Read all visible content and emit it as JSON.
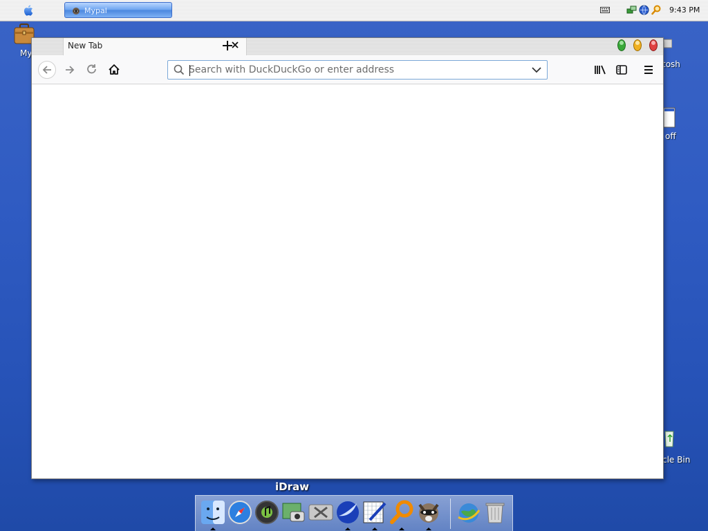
{
  "menubar": {
    "taskbar_app_label": "Mypal",
    "clock": "9:43 PM",
    "tray_icons": [
      "keyboard-icon",
      "network-icon",
      "globe-icon",
      "search-icon"
    ]
  },
  "desktop": {
    "icons": [
      {
        "name": "briefcase-icon",
        "label": "My Briefc"
      },
      {
        "name": "macintosh-hd-icon",
        "label": "tosh"
      },
      {
        "name": "shutoff-icon",
        "label": "off"
      },
      {
        "name": "recycle-bin-icon",
        "label": "cle Bin"
      }
    ]
  },
  "browser": {
    "tab_title": "New Tab",
    "url_placeholder": "Search with DuckDuckGo or enter address",
    "url_value": ""
  },
  "dock": {
    "hover_label": "iDraw",
    "items": [
      "finder-icon",
      "safari-icon",
      "itunes-icon",
      "iphoto-icon",
      "system-preferences-icon",
      "mypal-icon",
      "idraw-icon",
      "sherlock-icon",
      "raccoon-app-icon",
      "internet-icon",
      "trash-icon"
    ]
  },
  "colors": {
    "desktop_blue": "#2f5bc2",
    "url_focus_border": "#7aa8d8"
  }
}
